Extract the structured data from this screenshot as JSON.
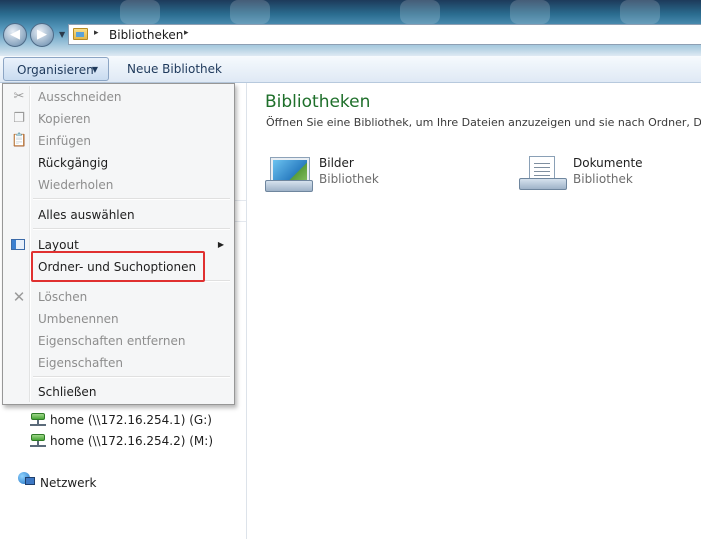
{
  "window": {
    "address": {
      "crumb": "Bibliotheken",
      "separator": "▸"
    }
  },
  "toolbar": {
    "organize_label": "Organisieren",
    "organize_caret": "▼",
    "new_library_label": "Neue Bibliothek"
  },
  "menu": {
    "items": [
      {
        "label": "Ausschneiden",
        "enabled": false,
        "icon": "scissors-icon"
      },
      {
        "label": "Kopieren",
        "enabled": false,
        "icon": "copy-icon"
      },
      {
        "label": "Einfügen",
        "enabled": false,
        "icon": "paste-icon"
      },
      {
        "label": "Rückgängig",
        "enabled": true
      },
      {
        "label": "Wiederholen",
        "enabled": false
      },
      {
        "label": "Alles auswählen",
        "enabled": true
      },
      {
        "label": "Layout",
        "enabled": true,
        "icon": "layout-icon",
        "submenu_arrow": "▶"
      },
      {
        "label": "Ordner- und Suchoptionen",
        "enabled": true,
        "highlighted": true
      },
      {
        "label": "Löschen",
        "enabled": false,
        "icon": "delete-icon"
      },
      {
        "label": "Umbenennen",
        "enabled": false
      },
      {
        "label": "Eigenschaften entfernen",
        "enabled": false
      },
      {
        "label": "Eigenschaften",
        "enabled": false
      },
      {
        "label": "Schließen",
        "enabled": true
      }
    ],
    "highlight_color": "#e03030"
  },
  "navpane": {
    "drives": [
      {
        "label": "home (\\\\172.16.254.1) (G:)"
      },
      {
        "label": "home (\\\\172.16.254.2) (M:)"
      }
    ],
    "network_label": "Netzwerk"
  },
  "content": {
    "title": "Bibliotheken",
    "subtitle": "Öffnen Sie eine Bibliothek, um Ihre Dateien anzuzeigen und sie nach Ordner, Datum",
    "title_color": "#1e6f2a",
    "libraries": [
      {
        "name": "Bilder",
        "type": "Bibliothek",
        "icon": "pictures-library-icon"
      },
      {
        "name": "Dokumente",
        "type": "Bibliothek",
        "icon": "documents-library-icon"
      }
    ]
  }
}
